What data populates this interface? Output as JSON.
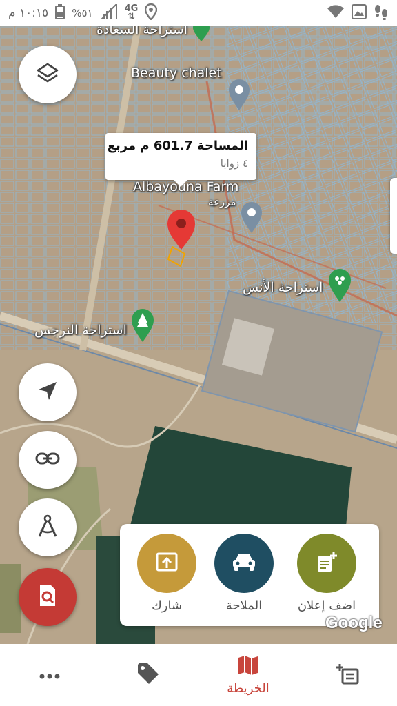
{
  "status_bar": {
    "time": "١٠:١٥ م",
    "battery": "%٥١",
    "network": "4G",
    "icons": [
      "wifi-icon",
      "gallery-icon",
      "footsteps-icon",
      "location-icon",
      "signal-icon",
      "battery-icon"
    ]
  },
  "map": {
    "callout": {
      "area_text": "المساحة 601.7 م مربع",
      "corners_text": "٤ زوايا"
    },
    "labels": {
      "place_top": "استراحة السعادة",
      "beauty_chalet": "Beauty chalet",
      "farm": "Albayouna Farm",
      "farm_ar": "مزرعة",
      "rest_alons": "استراحة الأنس",
      "rest_narjes": "استراحة النرجس"
    },
    "watermark": "Google",
    "colors": {
      "pin_red": "#e53935",
      "poi_green": "#2e9e4f",
      "poi_gray": "#7a8fa3"
    }
  },
  "fab": {
    "layers": "layers-icon",
    "locate": "navigation-arrow-icon",
    "link": "link-icon",
    "measure": "compass-measure-icon",
    "search": "search-document-icon"
  },
  "actions": {
    "share": "شارك",
    "navigate": "الملاحة",
    "add_ad": "اضف إعلان",
    "colors": {
      "share": "#c59a3a",
      "navigate": "#1f4e62",
      "add_ad": "#7f8a2a"
    }
  },
  "bottom_nav": {
    "more": "more-dots-icon",
    "tag": "tag-icon",
    "map_label": "الخريطة",
    "list": "add-list-icon",
    "accent": "#c8453c"
  }
}
